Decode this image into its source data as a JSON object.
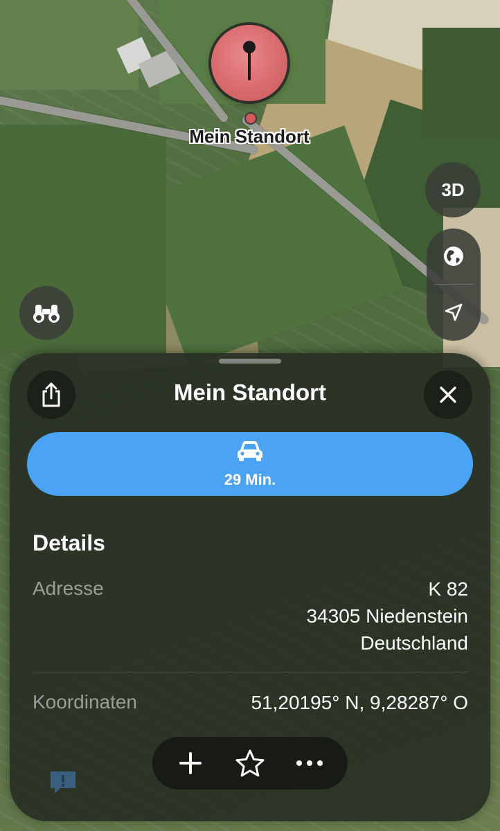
{
  "map": {
    "pin_label": "Mein Standort",
    "controls": {
      "view_3d_label": "3D",
      "globe_icon": "globe-icon",
      "location_icon": "location-arrow-icon",
      "lookaround_icon": "binoculars-icon"
    }
  },
  "sheet": {
    "title": "Mein Standort",
    "share_icon": "share-icon",
    "close_icon": "close-icon",
    "route": {
      "icon": "car-icon",
      "time": "29 Min."
    },
    "details": {
      "heading": "Details",
      "address_label": "Adresse",
      "address_line1": "K 82",
      "address_line2": "34305 Niedenstein",
      "address_line3": "Deutschland",
      "coordinates_label": "Koordinaten",
      "coordinates_value": "51,20195° N, 9,28287° O"
    },
    "toolbar": {
      "add_icon": "plus-icon",
      "favorite_icon": "star-icon",
      "more_icon": "ellipsis-icon"
    }
  },
  "colors": {
    "accent_blue": "#4aa4f3",
    "pin_red": "#d96a6e"
  }
}
